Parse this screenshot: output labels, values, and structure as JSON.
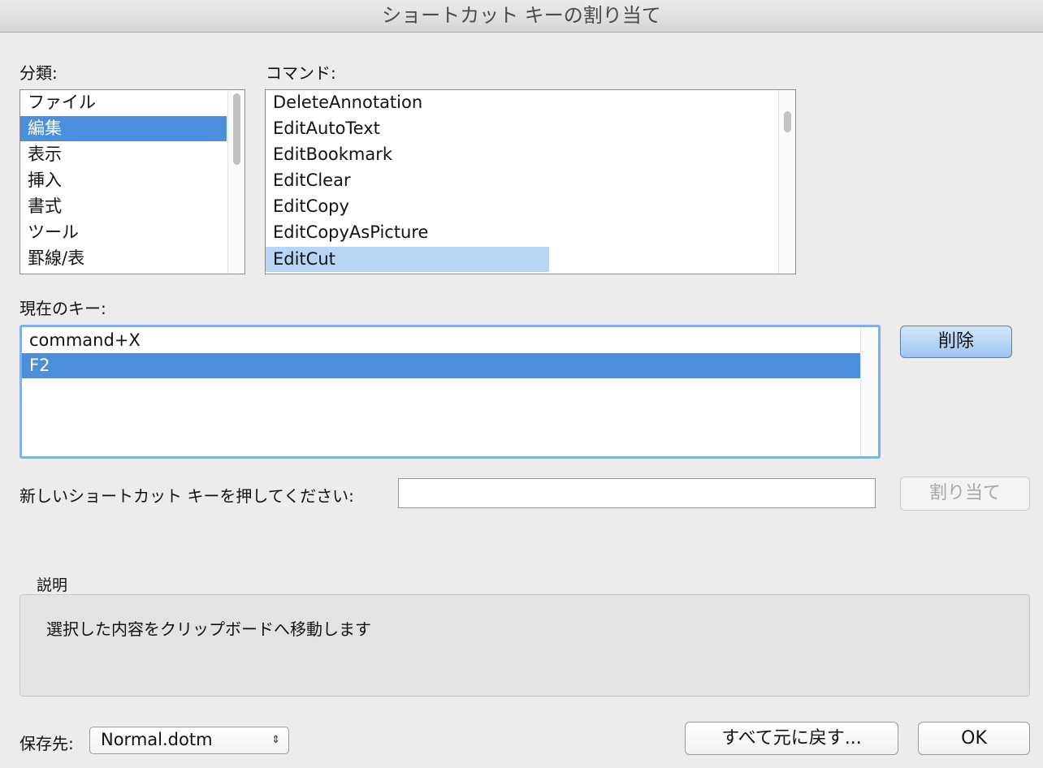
{
  "window": {
    "title": "ショートカット キーの割り当て"
  },
  "categories": {
    "label": "分類:",
    "items": [
      "ファイル",
      "編集",
      "表示",
      "挿入",
      "書式",
      "ツール",
      "罫線/表"
    ],
    "selected_index": 1
  },
  "commands": {
    "label": "コマンド:",
    "items": [
      "DeleteAnnotation",
      "EditAutoText",
      "EditBookmark",
      "EditClear",
      "EditCopy",
      "EditCopyAsPicture",
      "EditCut"
    ],
    "selected_index": 6
  },
  "current_keys": {
    "label": "現在のキー:",
    "items": [
      "command+X",
      "F2"
    ],
    "selected_index": 1,
    "remove_button": "削除"
  },
  "new_shortcut": {
    "label": "新しいショートカット キーを押してください:",
    "value": "",
    "assign_button": "割り当て"
  },
  "description": {
    "label": "説明",
    "text": "選択した内容をクリップボードへ移動します"
  },
  "save_in": {
    "label": "保存先:",
    "value": "Normal.dotm",
    "arrows_icon": "⇕"
  },
  "footer": {
    "reset_button": "すべて元に戻す...",
    "ok_button": "OK"
  },
  "colors": {
    "selection_active": "#4a8fdb",
    "selection_inactive": "#b8d5f7"
  }
}
